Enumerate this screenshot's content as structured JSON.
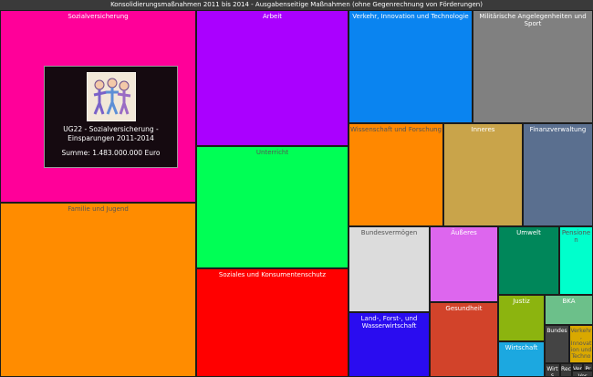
{
  "title": "Konsolidierungsmaßnahmen 2011 bis 2014 - Ausgabenseitige Maßnahmen (ohne Gegenrechnung von Förderungen)",
  "chart_data": {
    "type": "treemap",
    "cells": [
      {
        "label": "Sozialversicherung",
        "color": "#ff0099"
      },
      {
        "label": "Familie und Jugend",
        "color": "#ff8c00"
      },
      {
        "label": "Arbeit",
        "color": "#aa00ff"
      },
      {
        "label": "Unterricht",
        "color": "#00ff55"
      },
      {
        "label": "Soziales und Konsumentenschutz",
        "color": "#ff0000"
      },
      {
        "label": "Verkehr, Innovation und Technologie",
        "color": "#0a84f0"
      },
      {
        "label": "Militärische Angelegenheiten und Sport",
        "color": "#808080"
      },
      {
        "label": "Wissenschaft und Forschung",
        "color": "#ff8800"
      },
      {
        "label": "Inneres",
        "color": "#c9a44a"
      },
      {
        "label": "Finanzverwaltung",
        "color": "#5a6f8f"
      },
      {
        "label": "Bundesvermögen",
        "color": "#dcdcdc"
      },
      {
        "label": "Äußeres",
        "color": "#dd66ee"
      },
      {
        "label": "Umwelt",
        "color": "#00875a"
      },
      {
        "label": "Pensionen",
        "color": "#00ffcc"
      },
      {
        "label": "Land-, Forst-, und Wasserwirtschaft",
        "color": "#2a0cf0"
      },
      {
        "label": "Gesundheit",
        "color": "#d2432a"
      },
      {
        "label": "Justiz",
        "color": "#8cb40f"
      },
      {
        "label": "BKA",
        "color": "#6cc08a"
      },
      {
        "label": "Wirtschaft",
        "color": "#1ca8e0"
      },
      {
        "label": "Bundes",
        "color": "#444444"
      },
      {
        "label": "Verkehr, Innovation und Techno",
        "color": "#d9a800"
      },
      {
        "label": "Wirts (Fors",
        "color": "#3a3a3a"
      },
      {
        "label": "Rec",
        "color": "#3a3a3a"
      },
      {
        "label": "Ver",
        "color": "#3a3a3a"
      },
      {
        "label": "Pra",
        "color": "#3a3a3a"
      },
      {
        "label": "Ver",
        "color": "#3a3a3a"
      }
    ]
  },
  "tooltip": {
    "title": "UG22 - Sozialversicherung - Einsparungen 2011-2014",
    "amount": "Summe: 1.483.000.000 Euro",
    "icon": "family-icon"
  }
}
